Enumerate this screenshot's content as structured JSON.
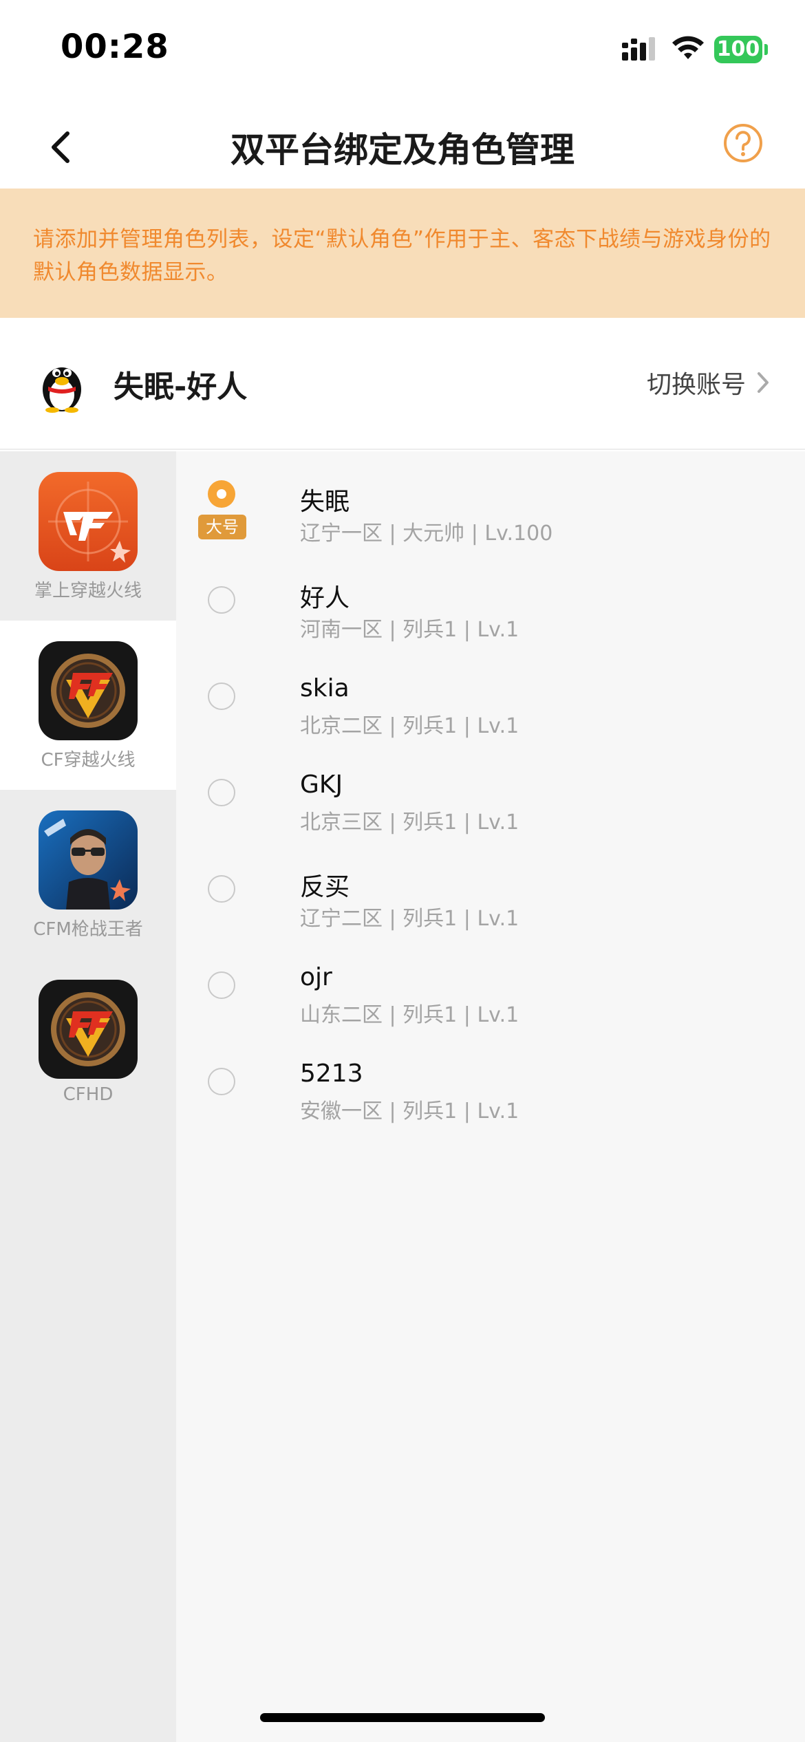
{
  "status_bar": {
    "time": "00:28",
    "battery": "100",
    "icons": [
      "cellular-signal-icon",
      "wifi-icon",
      "battery-icon"
    ]
  },
  "nav": {
    "title": "双平台绑定及角色管理",
    "back_icon": "chevron-left-icon",
    "help_icon": "question-circle-icon"
  },
  "notice": {
    "text": "请添加并管理角色列表，设定“默认角色”作用于主、客态下战绩与游戏身份的默认角色数据显示。"
  },
  "account": {
    "avatar_icon": "qq-penguin-icon",
    "name": "失眠-好人",
    "switch_label": "切换账号"
  },
  "games": [
    {
      "label": "掌上穿越火线",
      "icon": "cf-mobile-helper-icon",
      "active": false
    },
    {
      "label": "CF穿越火线",
      "icon": "cf-logo-icon",
      "active": true
    },
    {
      "label": "CFM枪战王者",
      "icon": "cfm-soldier-icon",
      "active": false
    },
    {
      "label": "CFHD",
      "icon": "cf-logo-icon",
      "active": false
    }
  ],
  "roles": [
    {
      "name": "失眠",
      "info": "辽宁一区 | 大元帅 | Lv.100",
      "selected": true,
      "badge": "大号"
    },
    {
      "name": "好人",
      "info": "河南一区 | 列兵1 | Lv.1",
      "selected": false
    },
    {
      "name": "skia",
      "info": "北京二区 | 列兵1 | Lv.1",
      "selected": false
    },
    {
      "name": "GKJ",
      "info": "北京三区 | 列兵1 | Lv.1",
      "selected": false
    },
    {
      "name": "反买",
      "info": "辽宁二区 | 列兵1 | Lv.1",
      "selected": false
    },
    {
      "name": "ojr",
      "info": "山东二区 | 列兵1 | Lv.1",
      "selected": false
    },
    {
      "name": "5213",
      "info": "安徽一区 | 列兵1 | Lv.1",
      "selected": false
    }
  ],
  "colors": {
    "accent": "#f7a536",
    "notice_bg": "#f8ddb9",
    "notice_text": "#f0892e",
    "battery": "#34c759"
  }
}
